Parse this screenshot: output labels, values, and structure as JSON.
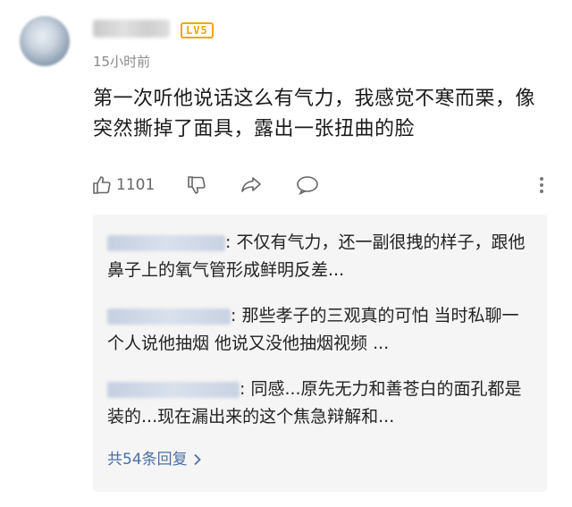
{
  "comment": {
    "username": "帐后",
    "level_badge": "LV5",
    "timestamp": "15小时前",
    "text": "第一次听他说话这么有气力，我感觉不寒而栗，像突然撕掉了面具，露出一张扭曲的脸",
    "like_count": "1101"
  },
  "icons": {
    "avatar": "avatar",
    "like": "thumbs-up-icon",
    "dislike": "thumbs-down-icon",
    "share": "share-arrow-icon",
    "reply": "speech-bubble-icon",
    "more": "more-vertical-icon"
  },
  "replies": {
    "items": [
      {
        "user": "",
        "text": ": 不仅有气力，还一副很拽的样子，跟他鼻子上的氧气管形成鲜明反差..."
      },
      {
        "user": "",
        "text": ": 那些孝子的三观真的可怕 当时私聊一个人说他抽烟 他说又没他抽烟视频 ..."
      },
      {
        "user": "",
        "text": ": 同感...原先无力和善苍白的面孔都是装的...现在漏出来的这个焦急辩解和..."
      }
    ],
    "see_all_label": "共54条回复"
  },
  "colors": {
    "badge": "#f0a500",
    "link": "#4a6fa5",
    "reply_background": "#f5f5f5"
  }
}
